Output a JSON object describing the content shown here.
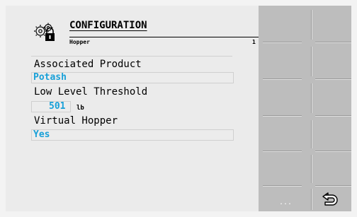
{
  "header": {
    "title": "CONFIGURATION",
    "subtitle": "Hopper",
    "number": "1",
    "icon": "gear-lock-icon"
  },
  "fields": {
    "associated_product_label": "Associated Product",
    "associated_product_value": "Potash",
    "low_level_threshold_label": "Low Level Threshold",
    "low_level_threshold_value": "501",
    "low_level_threshold_unit": "lb",
    "virtual_hopper_label": "Virtual Hopper",
    "virtual_hopper_value": "Yes"
  },
  "softkeys": {
    "more_label": "...",
    "back_icon": "return-arrow-icon"
  },
  "colors": {
    "value_accent": "#18a0d8",
    "softkey_bar": "#bdbdbd"
  }
}
